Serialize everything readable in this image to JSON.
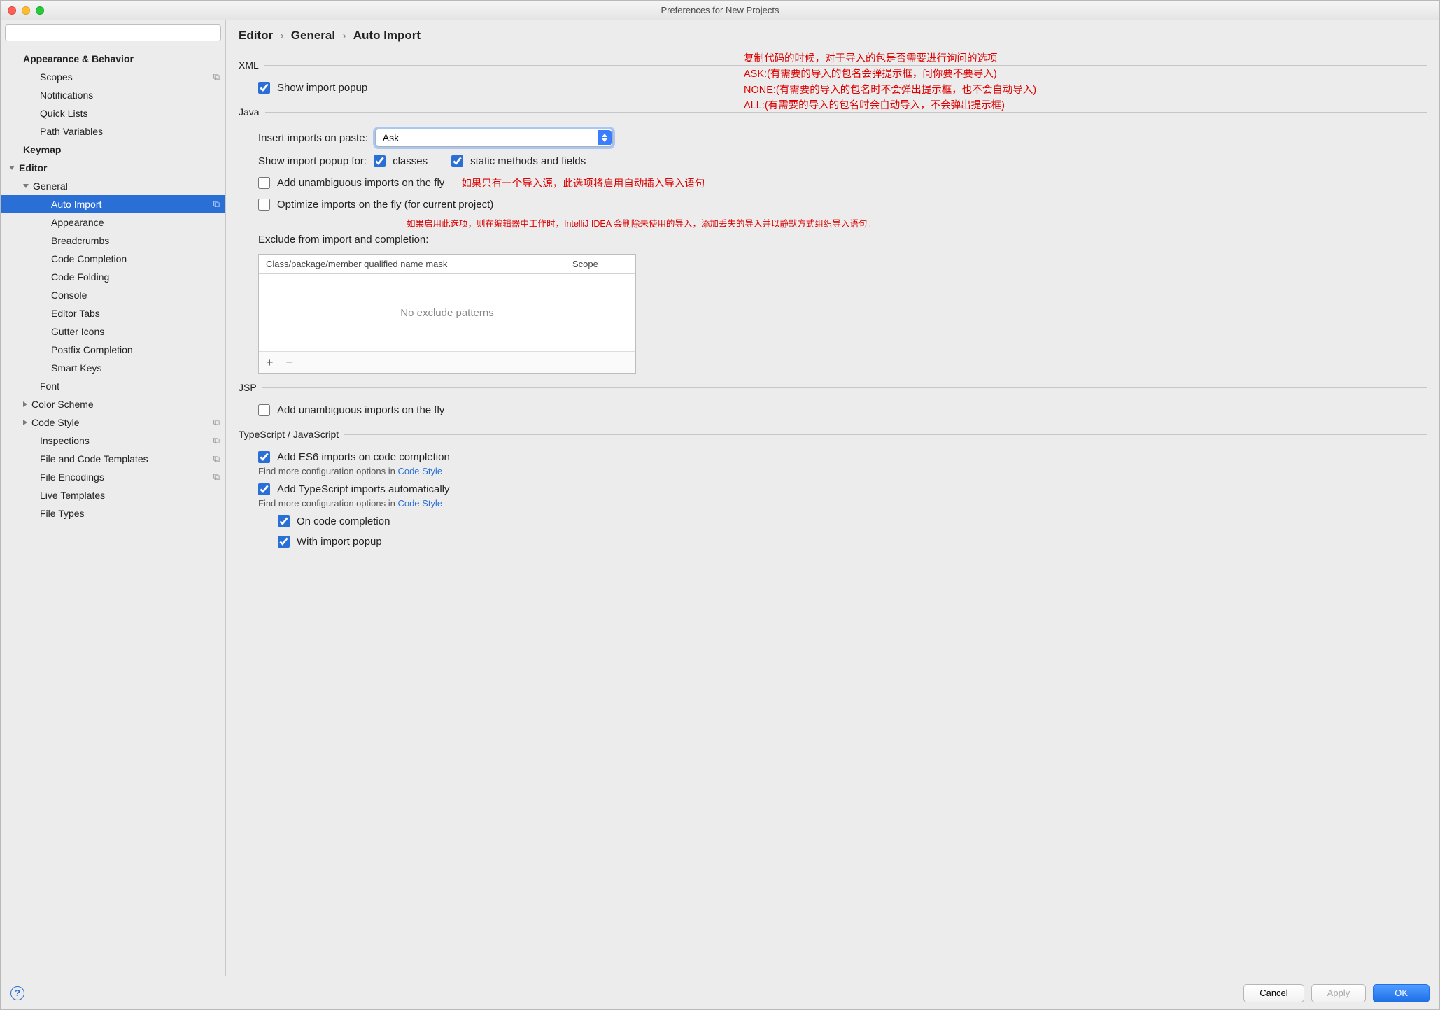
{
  "window": {
    "title": "Preferences for New Projects"
  },
  "search": {
    "placeholder": ""
  },
  "sidebar": {
    "items": [
      {
        "label": "Appearance & Behavior",
        "bold": true,
        "arrow": "none",
        "indent": 1
      },
      {
        "label": "Scopes",
        "indent": 2,
        "badge": true
      },
      {
        "label": "Notifications",
        "indent": 2
      },
      {
        "label": "Quick Lists",
        "indent": 2
      },
      {
        "label": "Path Variables",
        "indent": 2
      },
      {
        "label": "Keymap",
        "bold": true,
        "indent": 1
      },
      {
        "label": "Editor",
        "bold": true,
        "arrow": "down",
        "indent": 0
      },
      {
        "label": "General",
        "arrow": "down",
        "indent": 1
      },
      {
        "label": "Auto Import",
        "indent": 3,
        "selected": true,
        "badge": true
      },
      {
        "label": "Appearance",
        "indent": 3
      },
      {
        "label": "Breadcrumbs",
        "indent": 3
      },
      {
        "label": "Code Completion",
        "indent": 3
      },
      {
        "label": "Code Folding",
        "indent": 3
      },
      {
        "label": "Console",
        "indent": 3
      },
      {
        "label": "Editor Tabs",
        "indent": 3
      },
      {
        "label": "Gutter Icons",
        "indent": 3
      },
      {
        "label": "Postfix Completion",
        "indent": 3
      },
      {
        "label": "Smart Keys",
        "indent": 3
      },
      {
        "label": "Font",
        "indent": 2
      },
      {
        "label": "Color Scheme",
        "arrow": "right",
        "indent": 1
      },
      {
        "label": "Code Style",
        "arrow": "right",
        "indent": 1,
        "badge": true
      },
      {
        "label": "Inspections",
        "indent": 2,
        "badge": true
      },
      {
        "label": "File and Code Templates",
        "indent": 2,
        "badge": true
      },
      {
        "label": "File Encodings",
        "indent": 2,
        "badge": true
      },
      {
        "label": "Live Templates",
        "indent": 2
      },
      {
        "label": "File Types",
        "indent": 2
      }
    ]
  },
  "breadcrumb": {
    "a": "Editor",
    "b": "General",
    "c": "Auto Import",
    "sep": "›"
  },
  "sections": {
    "xml": {
      "legend": "XML",
      "show_import_popup": "Show import popup"
    },
    "java": {
      "legend": "Java",
      "insert_label": "Insert imports on paste:",
      "insert_value": "Ask",
      "popup_label": "Show import popup for:",
      "cb_classes": "classes",
      "cb_static": "static methods and fields",
      "add_unambig": "Add unambiguous imports on the fly",
      "optimize": "Optimize imports on the fly (for current project)",
      "exclude_label": "Exclude from import and completion:",
      "col1": "Class/package/member qualified name mask",
      "col2": "Scope",
      "empty": "No exclude patterns"
    },
    "jsp": {
      "legend": "JSP",
      "add_unambig": "Add unambiguous imports on the fly"
    },
    "ts": {
      "legend": "TypeScript / JavaScript",
      "add_es6": "Add ES6 imports on code completion",
      "find1a": "Find more configuration options in ",
      "find1b": "Code Style",
      "add_ts": "Add TypeScript imports automatically",
      "on_completion": "On code completion",
      "with_popup": "With import popup"
    }
  },
  "annotations": {
    "block": [
      "复制代码的时候，对于导入的包是否需要进行询问的选项",
      "ASK:(有需要的导入的包名会弹提示框，问你要不要导入)",
      "NONE:(有需要的导入的包名时不会弹出提示框，也不会自动导入)",
      "ALL:(有需要的导入的包名时会自动导入，不会弹出提示框)"
    ],
    "inline_unambig": "如果只有一个导入源，此选项将启用自动插入导入语句",
    "below_optimize": "如果启用此选项，则在编辑器中工作时，IntelliJ IDEA 会删除未使用的导入，添加丢失的导入并以静默方式组织导入语句。"
  },
  "footer": {
    "cancel": "Cancel",
    "apply": "Apply",
    "ok": "OK"
  }
}
